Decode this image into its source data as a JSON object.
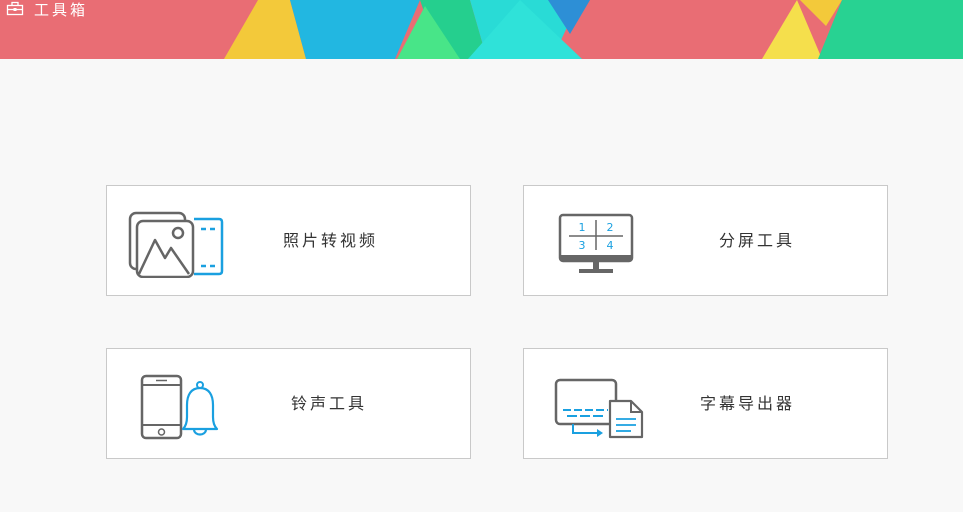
{
  "header": {
    "title": "工具箱",
    "icon": "toolbox-icon"
  },
  "tools": [
    {
      "label": "照片转视频",
      "icon": "photo-to-video-icon"
    },
    {
      "label": "分屏工具",
      "icon": "split-screen-icon",
      "quadrants": [
        "1",
        "2",
        "3",
        "4"
      ]
    },
    {
      "label": "铃声工具",
      "icon": "ringtone-icon"
    },
    {
      "label": "字幕导出器",
      "icon": "subtitle-export-icon"
    }
  ],
  "colors": {
    "accent_blue": "#1aa0e0",
    "icon_gray": "#666666",
    "banner_red": "#e96d74"
  }
}
